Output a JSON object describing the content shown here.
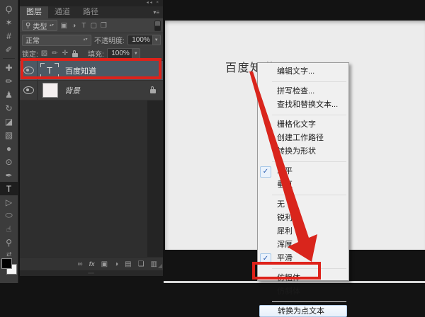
{
  "colors": {
    "annotation_red": "#de221a",
    "selected_row": "#4d5964",
    "canvas_bg": "#ececec"
  },
  "panel_header": {
    "collapse_icon": "◂◂",
    "close_icon": "×",
    "panel_menu_icon": "▾≡"
  },
  "tabs": [
    {
      "label": "图层",
      "active": true
    },
    {
      "label": "通道",
      "active": false
    },
    {
      "label": "路径",
      "active": false
    }
  ],
  "filter_row": {
    "search_icon": "⚲",
    "label": "类型",
    "updown_icon": "▴▾",
    "icons": [
      {
        "name": "filter-pixel-layers-icon",
        "glyph": "▣"
      },
      {
        "name": "filter-adjustment-layers-icon",
        "glyph": "◑"
      },
      {
        "name": "filter-type-layers-icon",
        "glyph": "T"
      },
      {
        "name": "filter-shape-layers-icon",
        "glyph": "▢"
      },
      {
        "name": "filter-smart-objects-icon",
        "glyph": "❐"
      }
    ]
  },
  "blend_row": {
    "mode": "正常",
    "updown_icon": "▴▾",
    "opacity_label": "不透明度:",
    "opacity_value": "100%",
    "dropdown_icon": "▼"
  },
  "lock_row": {
    "label": "锁定:",
    "fill_label": "填充:",
    "fill_value": "100%",
    "dropdown_icon": "▼",
    "icons": [
      {
        "name": "lock-transparent-pixels-icon",
        "glyph": "▨"
      },
      {
        "name": "lock-image-pixels-icon",
        "glyph": "✏"
      },
      {
        "name": "lock-position-icon",
        "glyph": "✛"
      },
      {
        "name": "lock-all-icon",
        "glyph": "padlock"
      }
    ]
  },
  "layers": [
    {
      "name": "百度知道",
      "kind": "text",
      "selected": true,
      "visible": true,
      "locked": false
    },
    {
      "name": "背景",
      "kind": "background",
      "selected": false,
      "visible": true,
      "locked": true
    }
  ],
  "bottom_bar": {
    "icons": [
      {
        "name": "link-layers-icon",
        "glyph": "∞"
      },
      {
        "name": "layer-style-icon",
        "glyph": "fx"
      },
      {
        "name": "add-layer-mask-icon",
        "glyph": "▣"
      },
      {
        "name": "adjustment-layer-icon",
        "glyph": "◑"
      },
      {
        "name": "new-group-icon",
        "glyph": "▤"
      },
      {
        "name": "new-layer-icon",
        "glyph": "❏"
      },
      {
        "name": "delete-layer-icon",
        "glyph": "▥"
      }
    ],
    "grip_icon": "┅┅",
    "resize_icon": "◢"
  },
  "toolbar": {
    "tools": [
      {
        "name": "lasso-tool-icon",
        "glyph": "Ϙ"
      },
      {
        "name": "magic-wand-tool-icon",
        "glyph": "✶"
      },
      {
        "name": "crop-tool-icon",
        "glyph": "#"
      },
      {
        "name": "eyedropper-tool-icon",
        "glyph": "✐"
      },
      {
        "name": "healing-brush-tool-icon",
        "glyph": "✚"
      },
      {
        "name": "brush-tool-icon",
        "glyph": "✏"
      },
      {
        "name": "clone-stamp-tool-icon",
        "glyph": "♟"
      },
      {
        "name": "history-brush-tool-icon",
        "glyph": "↻"
      },
      {
        "name": "eraser-tool-icon",
        "glyph": "◪"
      },
      {
        "name": "gradient-tool-icon",
        "glyph": "▧"
      },
      {
        "name": "blur-tool-icon",
        "glyph": "●"
      },
      {
        "name": "dodge-tool-icon",
        "glyph": "⊙"
      },
      {
        "name": "pen-tool-icon",
        "glyph": "✒"
      },
      {
        "name": "type-tool-icon",
        "glyph": "T",
        "active": true
      },
      {
        "name": "path-selection-tool-icon",
        "glyph": "▷"
      },
      {
        "name": "shape-tool-icon",
        "glyph": "⬭"
      },
      {
        "name": "hand-tool-icon",
        "glyph": "☝"
      },
      {
        "name": "zoom-tool-icon",
        "glyph": "⚲"
      }
    ],
    "divider_after_index": 3,
    "swap_icon": "⇄",
    "foreground_color": "#000000",
    "background_color": "#ffffff"
  },
  "canvas": {
    "text": "百度知道"
  },
  "context_menu": {
    "items": [
      {
        "type": "item",
        "label": "编辑文字..."
      },
      {
        "type": "separator"
      },
      {
        "type": "item",
        "label": "拼写检查..."
      },
      {
        "type": "item",
        "label": "查找和替换文本..."
      },
      {
        "type": "separator"
      },
      {
        "type": "item",
        "label": "栅格化文字"
      },
      {
        "type": "item",
        "label": "创建工作路径"
      },
      {
        "type": "item",
        "label": "转换为形状"
      },
      {
        "type": "separator"
      },
      {
        "type": "item",
        "label": "水平",
        "checked": true
      },
      {
        "type": "item",
        "label": "垂直"
      },
      {
        "type": "separator"
      },
      {
        "type": "item",
        "label": "无"
      },
      {
        "type": "item",
        "label": "锐利"
      },
      {
        "type": "item",
        "label": "犀利"
      },
      {
        "type": "item",
        "label": "浑厚"
      },
      {
        "type": "item",
        "label": "平滑",
        "checked": true
      },
      {
        "type": "separator"
      },
      {
        "type": "item",
        "label": "仿粗体"
      },
      {
        "type": "item",
        "label": "仿斜体"
      },
      {
        "type": "separator"
      },
      {
        "type": "item",
        "label": "转换为点文本",
        "highlighted": true
      }
    ],
    "check_glyph": "✓"
  }
}
